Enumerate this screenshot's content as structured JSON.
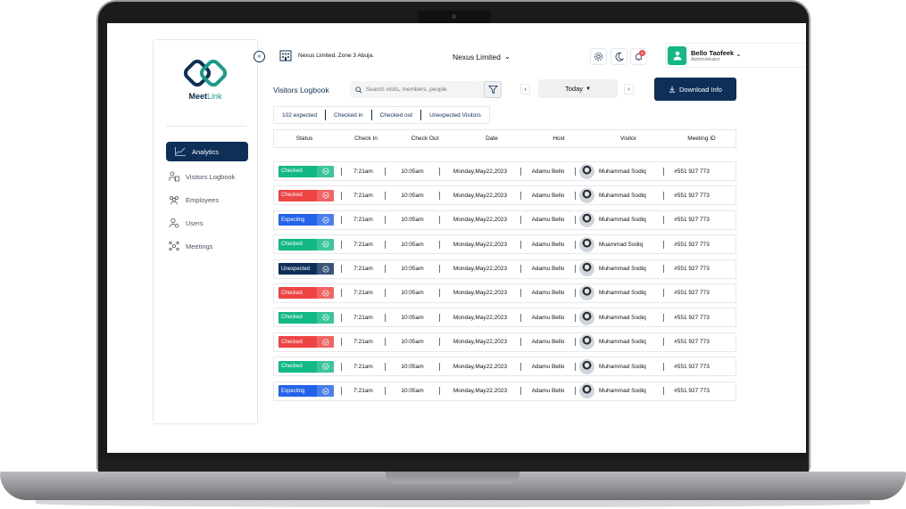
{
  "app": {
    "logo_name": "Meet",
    "logo_accent": "Link"
  },
  "sidebar": {
    "items": [
      {
        "label": "Analytics",
        "icon": "chart-line-icon",
        "active": true
      },
      {
        "label": "Visitors Logbook",
        "icon": "visitors-icon",
        "active": false
      },
      {
        "label": "Employees",
        "icon": "employees-icon",
        "active": false
      },
      {
        "label": "Users",
        "icon": "users-gear-icon",
        "active": false
      },
      {
        "label": "Meetings",
        "icon": "meetings-icon",
        "active": false
      }
    ]
  },
  "header": {
    "org_label": "Nexus Limited, Zone 3 Abuja.",
    "company": "Nexus Limited",
    "user_name": "Bello Taofeek",
    "user_role": "Administrator",
    "notification_count": "8"
  },
  "toolbar": {
    "title": "Visitors Logbook",
    "search_placeholder": "Search visits, members, people",
    "date_label": "Today",
    "download_label": "Download Info"
  },
  "stats": [
    "102 expected",
    "Checked in",
    "Checked out",
    "Unexpected Visitors"
  ],
  "table": {
    "headers": [
      "Status",
      "Check In",
      "Check Out",
      "Date",
      "Host",
      "Visitor",
      "Meeting ID"
    ],
    "rows": [
      {
        "status": "Checked",
        "color": "#12b886",
        "in": "7:21am",
        "out": "10:05am",
        "date": "Monday,May22,2023",
        "host": "Adamu Bello",
        "visitor": "Muhammad Sodiq",
        "id": "#551 927 773"
      },
      {
        "status": "Checked",
        "color": "#ef4444",
        "in": "7:21am",
        "out": "10:05am",
        "date": "Monday,May22,2023",
        "host": "Adamu Bello",
        "visitor": "Muhammad Sodiq",
        "id": "#551 927 773"
      },
      {
        "status": "Expecting",
        "color": "#2563eb",
        "in": "7:21am",
        "out": "10:05am",
        "date": "Monday,May22,2023",
        "host": "Adamu Bello",
        "visitor": "Muhammad Sodiq",
        "id": "#551 927 773"
      },
      {
        "status": "Checked",
        "color": "#12b886",
        "in": "7:21am",
        "out": "10:05am",
        "date": "Monday,May22,2023",
        "host": "Adamu Bello",
        "visitor": "Muammad Sodiq",
        "id": "#551 927 773"
      },
      {
        "status": "Unexpected",
        "color": "#0e2f57",
        "in": "7:21am",
        "out": "10:05am",
        "date": "Monday,May22,2023",
        "host": "Adamu Bello",
        "visitor": "Muhammad Sodiq",
        "id": "#551 927 773"
      },
      {
        "status": "Checked",
        "color": "#ef4444",
        "in": "7:21am",
        "out": "10:05am",
        "date": "Monday,May22,2023",
        "host": "Adamu Bello",
        "visitor": "Muhammad Sodiq",
        "id": "#551 927 773"
      },
      {
        "status": "Checked",
        "color": "#12b886",
        "in": "7:21am",
        "out": "10:05am",
        "date": "Monday,May22,2023",
        "host": "Adamu Bello",
        "visitor": "Muhammad Sodiq",
        "id": "#551 927 773"
      },
      {
        "status": "Checked",
        "color": "#ef4444",
        "in": "7:21am",
        "out": "10:05am",
        "date": "Monday,May22,2023",
        "host": "Adamu Bello",
        "visitor": "Muhammad Sodiq",
        "id": "#551 927 773"
      },
      {
        "status": "Checked",
        "color": "#12b886",
        "in": "7:21am",
        "out": "10:05am",
        "date": "Monday,May22,2023",
        "host": "Adamu Bello",
        "visitor": "Muhammad Sodiq",
        "id": "#551 927 773"
      },
      {
        "status": "Expecting",
        "color": "#2563eb",
        "in": "7:21am",
        "out": "10:05am",
        "date": "Monday,May22,2023",
        "host": "Adamu Bello",
        "visitor": "Muhammad Sodiq",
        "id": "#551 927 773"
      }
    ]
  }
}
